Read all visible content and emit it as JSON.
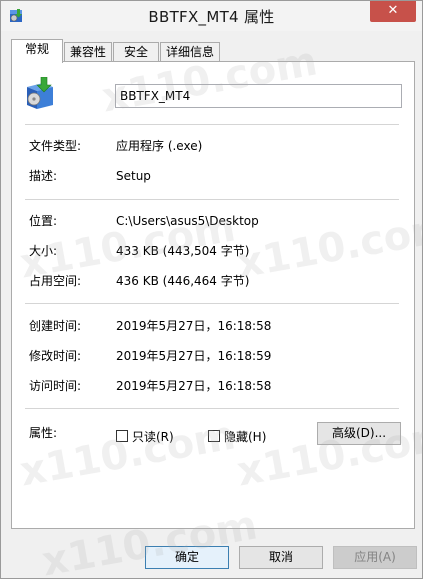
{
  "window": {
    "title": "BBTFX_MT4 属性",
    "close_glyph": "✕"
  },
  "tabs": [
    {
      "label": "常规",
      "active": true
    },
    {
      "label": "兼容性",
      "active": false
    },
    {
      "label": "安全",
      "active": false
    },
    {
      "label": "详细信息",
      "active": false
    }
  ],
  "general": {
    "file_name": "BBTFX_MT4",
    "file_type_label": "文件类型:",
    "file_type_value": "应用程序 (.exe)",
    "description_label": "描述:",
    "description_value": "Setup",
    "location_label": "位置:",
    "location_value": "C:\\Users\\asus5\\Desktop",
    "size_label": "大小:",
    "size_value": "433 KB (443,504 字节)",
    "size_on_disk_label": "占用空间:",
    "size_on_disk_value": "436 KB (446,464 字节)",
    "created_label": "创建时间:",
    "created_value": "2019年5月27日，16:18:58",
    "modified_label": "修改时间:",
    "modified_value": "2019年5月27日，16:18:59",
    "accessed_label": "访问时间:",
    "accessed_value": "2019年5月27日，16:18:58",
    "attributes_label": "属性:",
    "readonly_label": "只读(R)",
    "hidden_label": "隐藏(H)",
    "advanced_label": "高级(D)..."
  },
  "footer": {
    "ok_label": "确定",
    "cancel_label": "取消",
    "apply_label": "应用(A)"
  },
  "watermark_text": "x110.com",
  "colors": {
    "close_button": "#c7514a",
    "panel_bg": "#ffffff",
    "window_bg": "#f0f0f0",
    "default_button_border": "#3c7fb1"
  },
  "icons": {
    "title_icon": "installer-icon",
    "app_icon": "installer-box-icon"
  }
}
